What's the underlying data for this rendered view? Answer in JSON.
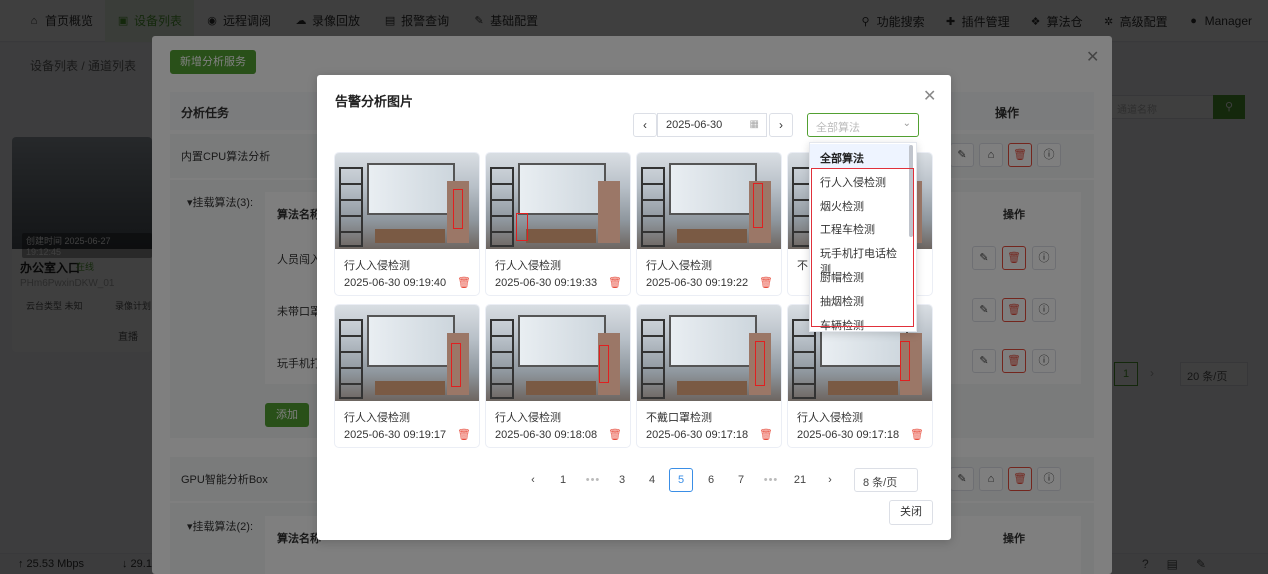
{
  "topnav": {
    "left": [
      {
        "label": "首页概览",
        "icon": "home-icon",
        "glyph": "⌂"
      },
      {
        "label": "设备列表",
        "icon": "device-icon",
        "glyph": "▣"
      },
      {
        "label": "远程调阅",
        "icon": "remote-icon",
        "glyph": "◉"
      },
      {
        "label": "录像回放",
        "icon": "cloud-icon",
        "glyph": "☁"
      },
      {
        "label": "报警查询",
        "icon": "alarm-icon",
        "glyph": "▤"
      },
      {
        "label": "基础配置",
        "icon": "pencil-icon",
        "glyph": "✎"
      }
    ],
    "active_index": 1,
    "right": [
      {
        "label": "功能搜索",
        "icon": "search-icon",
        "glyph": "⚲"
      },
      {
        "label": "插件管理",
        "icon": "puzzle-icon",
        "glyph": "✚"
      },
      {
        "label": "算法仓",
        "icon": "dropbox-icon",
        "glyph": "❖"
      },
      {
        "label": "高级配置",
        "icon": "gear-icon",
        "glyph": "✲"
      },
      {
        "label": "Manager",
        "icon": "user-icon",
        "glyph": "●"
      }
    ]
  },
  "background": {
    "breadcrumb": "设备列表 / 通道列表",
    "camera": {
      "time": "创建时间 2025-06-27 19:12:45",
      "name": "办公室入口",
      "status": "在线",
      "id": "PHm6PwxinDKW_01",
      "ptz": "云台类型 未知",
      "record": "录像计划",
      "live": "直播"
    },
    "search_placeholder": "通道名称",
    "pager_current": "1",
    "pager_size": "20 条/页"
  },
  "outer_modal": {
    "add_button": "新增分析服务",
    "header_task": "分析任务",
    "header_ops": "操作",
    "task1": "内置CPU算法分析",
    "task1_algos": "▾挂载算法(3):",
    "table_header_name": "算法名称",
    "table_header_ops": "操作",
    "task1_rows": [
      "人员闯入",
      "未带口罩",
      "玩手机打"
    ],
    "add_algo": "添加",
    "task2": "GPU智能分析Box",
    "task2_algos": "▾挂载算法(2):"
  },
  "inner_modal": {
    "title": "告警分析图片",
    "date": "2025-06-30",
    "algo_placeholder": "全部算法",
    "cards": [
      {
        "label": "行人入侵检测",
        "time": "2025-06-30 09:19:40"
      },
      {
        "label": "行人入侵检测",
        "time": "2025-06-30 09:19:33"
      },
      {
        "label": "行人入侵检测",
        "time": "2025-06-30 09:19:22"
      },
      {
        "label": "不",
        "time": ""
      },
      {
        "label": "行人入侵检测",
        "time": "2025-06-30 09:19:17"
      },
      {
        "label": "行人入侵检测",
        "time": "2025-06-30 09:18:08"
      },
      {
        "label": "不戴口罩检测",
        "time": "2025-06-30 09:17:18"
      },
      {
        "label": "行人入侵检测",
        "time": "2025-06-30 09:17:18"
      }
    ],
    "pagination": {
      "pages": [
        "1",
        "•••",
        "3",
        "4",
        "5",
        "6",
        "7",
        "•••",
        "21"
      ],
      "current": "5",
      "page_size": "8 条/页"
    },
    "close_label": "关闭"
  },
  "dropdown": {
    "options": [
      "全部算法",
      "行人入侵检测",
      "烟火检测",
      "工程车检测",
      "玩手机打电话检测",
      "厨帽检测",
      "抽烟检测",
      "车辆检测"
    ],
    "selected": "全部算法"
  },
  "statusbar": {
    "upload": "↑ 25.53 Mbps",
    "download": "↓ 29.1"
  }
}
